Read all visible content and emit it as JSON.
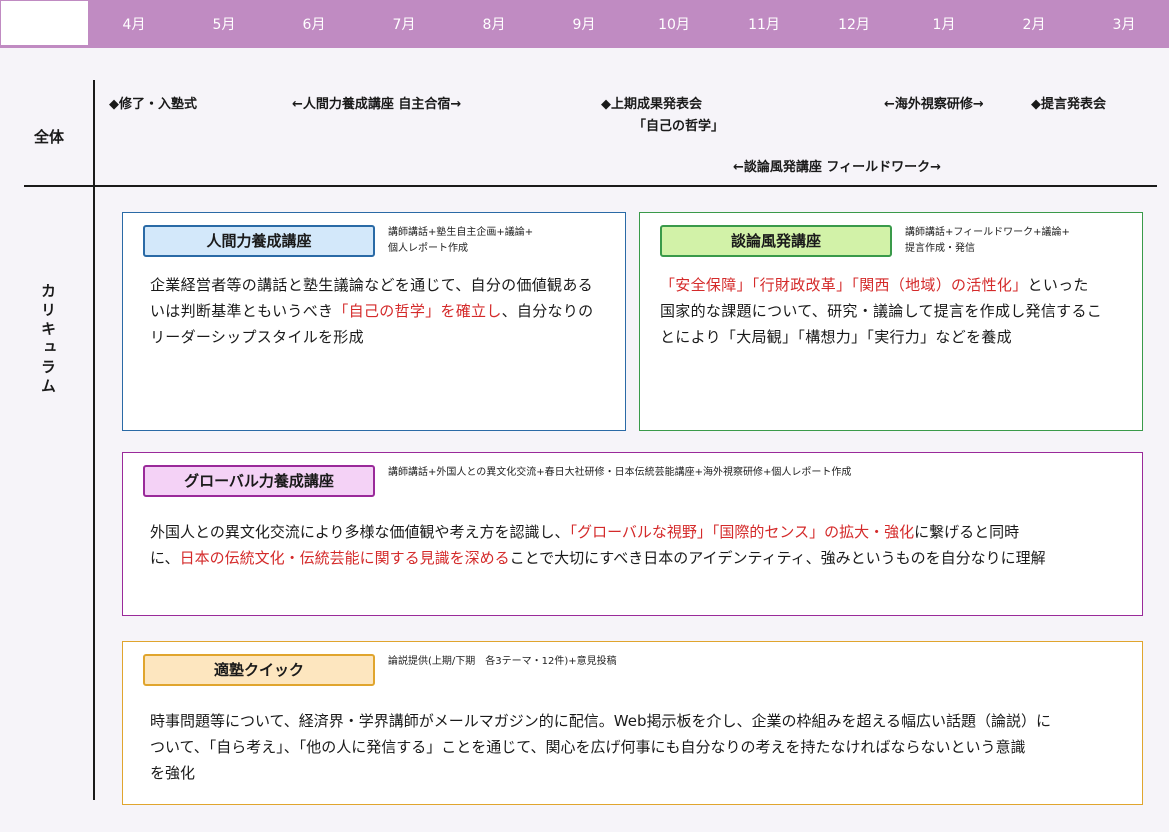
{
  "months": [
    "4月",
    "5月",
    "6月",
    "7月",
    "8月",
    "9月",
    "10月",
    "11月",
    "12月",
    "1月",
    "2月",
    "3月"
  ],
  "rows": {
    "overall": "全体",
    "curriculum": "カリキュラム"
  },
  "events": {
    "e1": "◆修了・入塾式",
    "e2": "←人間力養成講座 自主合宿→",
    "e3": "◆上期成果発表会",
    "e3b": "「自己の哲学」",
    "e4": "←海外視察研修→",
    "e5": "◆提言発表会",
    "e6": "←談論風発講座 フィールドワーク→"
  },
  "cards": {
    "ningen": {
      "title": "人間力養成講座",
      "sub": "講師講話+塾生自主企画+議論+\n個人レポート作成",
      "b1": "企業経営者等の講話と塾生議論などを通じて、自分の価値観ある",
      "b2a": "いは判断基準ともいうべき",
      "b2r": "「自己の哲学」を確立し",
      "b2b": "、自分なりの",
      "b3": "リーダーシップスタイルを形成"
    },
    "danron": {
      "title": "談論風発講座",
      "sub": "講師講話+フィールドワーク+議論+\n提言作成・発信",
      "b1r": "「安全保障」「行財政改革」「関西（地域）の活性化」",
      "b1b": "といった",
      "b2": "国家的な課題について、研究・議論して提言を作成し発信するこ",
      "b3": "とにより「大局観」「構想力」「実行力」などを養成"
    },
    "global": {
      "title": "グローバル力養成講座",
      "sub": "講師講話+外国人との異文化交流+春日大社研修・日本伝統芸能講座+海外視察研修+個人レポート作成",
      "b1a": "外国人との異文化交流により多様な価値観や考え方を認識し、",
      "b1r": "「グローバルな視野」「国際的センス」の拡大・強化",
      "b1b": "に繋げると同時",
      "b2a": "に、",
      "b2r": "日本の伝統文化・伝統芸能に関する見識を深める",
      "b2b": "ことで大切にすべき日本のアイデンティティ、強みというものを自分なりに理解"
    },
    "tekijuku": {
      "title": "適塾クイック",
      "sub": "論説提供(上期/下期　各3テーマ・12件)+意見投稿",
      "b1": "時事問題等について、経済界・学界講師がメールマガジン的に配信。Web掲示板を介し、企業の枠組みを超える幅広い話題（論説）に",
      "b2": "ついて、「自ら考え」、「他の人に発信する」ことを通じて、関心を広げ何事にも自分なりの考えを持たなければならないという意識",
      "b3": "を強化"
    }
  },
  "colors": {
    "header": "#c08bc2",
    "ningen_border": "#2a6aa6",
    "ningen_fill": "#d3e8fa",
    "danron_border": "#3a9a4a",
    "danron_fill": "#d2f2a8",
    "global_border": "#9a2a9a",
    "global_fill": "#f4d2f6",
    "tekijuku_border": "#e0a52e",
    "tekijuku_fill": "#fde6bf",
    "highlight": "#d42a2a"
  }
}
